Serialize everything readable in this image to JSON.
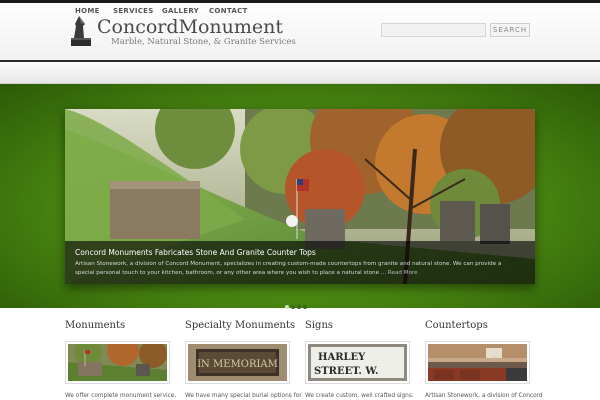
{
  "header": {
    "logo_title": "ConcordMonument",
    "logo_subtitle": "Marble, Natural Stone, & Granite Services",
    "search_placeholder": "",
    "search_button": "SEARCH"
  },
  "nav": {
    "items": [
      {
        "label": "HOME"
      },
      {
        "label": "SERVICES"
      },
      {
        "label": "GALLERY"
      },
      {
        "label": "CONTACT"
      }
    ]
  },
  "slider": {
    "caption_title": "Concord Monuments Fabricates Stone And Granite Counter Tops",
    "caption_text": "Artisan Stonework, a division of Concord Monument, specializes in creating custom-made countertops from granite and natural stone. We can provide a special personal touch to your kitchen, bathroom, or any other area where you wish to place a natural stone ...",
    "read_more": "Read More",
    "slide_count": 4,
    "active_slide": 1
  },
  "columns": [
    {
      "title": "Monuments",
      "text": "We offer complete monument service,"
    },
    {
      "title": "Specialty Monuments",
      "text": "We have many special burial options for"
    },
    {
      "title": "Signs",
      "text": "We create custom, well crafted signs."
    },
    {
      "title": "Countertops",
      "text": "Artisan Stonework, a division of Concord"
    }
  ],
  "thumbnails": {
    "memoriam_plaque": "IN MEMORIAM",
    "street_sign_line1": "HARLEY",
    "street_sign_line2": "STREET. W."
  },
  "colors": {
    "hero_green": "#4e8d13",
    "nav_text": "#555555",
    "top_bar": "#1a1a1a"
  }
}
